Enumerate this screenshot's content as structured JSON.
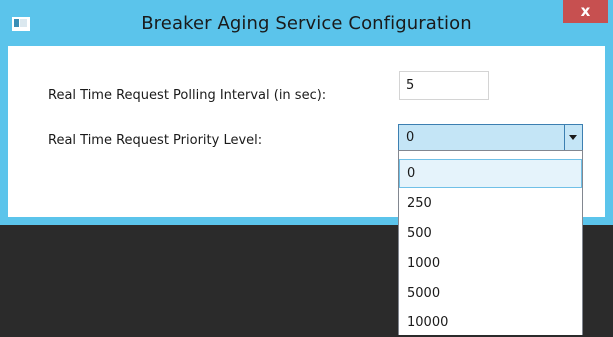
{
  "window": {
    "title": "Breaker Aging Service Configuration",
    "close_label": "x",
    "colors": {
      "frame": "#5bc4eb",
      "close": "#c75050",
      "combo": "#c4e5f6"
    }
  },
  "form": {
    "polling_label": "Real Time Request Polling Interval (in sec):",
    "polling_value": "5",
    "priority_label": "Real Time Request Priority Level:",
    "priority_value": "0",
    "priority_options": [
      "0",
      "250",
      "500",
      "1000",
      "5000",
      "10000"
    ]
  }
}
